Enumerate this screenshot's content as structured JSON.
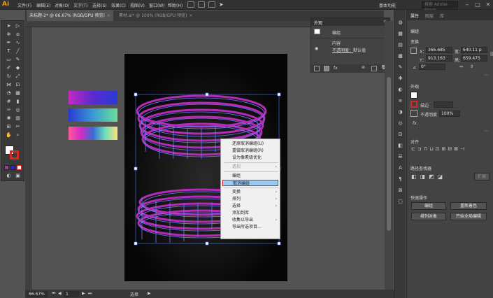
{
  "app": {
    "logo": "Ai"
  },
  "menu": [
    "文件(F)",
    "编辑(E)",
    "对象(O)",
    "文字(T)",
    "选择(S)",
    "效果(C)",
    "视图(V)",
    "窗口(W)",
    "帮助(H)"
  ],
  "topbar": {
    "workspace": "基本功能",
    "search_placeholder": "搜索 Adobe Stock"
  },
  "tabs": [
    {
      "label": "未标题-2* @ 66.67% (RGB/GPU 预览)",
      "active": true
    },
    {
      "label": "素材.ai* @ 100% (RGB/GPU 预览)",
      "active": false
    }
  ],
  "appearance": {
    "title": "外观",
    "rows": [
      {
        "label": "编组"
      },
      {
        "label": "内容"
      },
      {
        "label": "不透明度：",
        "value": "默认值"
      }
    ]
  },
  "context_menu": {
    "items": [
      {
        "label": "还原取消编组(U)",
        "disabled": false,
        "submenu": false
      },
      {
        "label": "重做取消编组(R)",
        "disabled": false,
        "submenu": false
      },
      {
        "label": "设为像素级优化",
        "disabled": false,
        "submenu": false,
        "sep_after": true
      },
      {
        "label": "透视",
        "disabled": true,
        "submenu": true,
        "sep_after": true
      },
      {
        "label": "编组",
        "disabled": false,
        "submenu": false
      },
      {
        "label": "取消编组",
        "disabled": false,
        "submenu": false,
        "highlighted": true,
        "sep_after": true
      },
      {
        "label": "变换",
        "disabled": false,
        "submenu": true
      },
      {
        "label": "排列",
        "disabled": false,
        "submenu": true
      },
      {
        "label": "选择",
        "disabled": false,
        "submenu": true
      },
      {
        "label": "添加到库",
        "disabled": false,
        "submenu": false
      },
      {
        "label": "收集以导出",
        "disabled": false,
        "submenu": true
      },
      {
        "label": "导出所选项目...",
        "disabled": false,
        "submenu": false
      }
    ]
  },
  "status": {
    "zoom": "66.67%",
    "page": "1",
    "tool": "选择"
  },
  "properties": {
    "tabs": [
      {
        "label": "属性",
        "active": true
      },
      {
        "label": "图层",
        "active": false
      },
      {
        "label": "库",
        "active": false
      }
    ],
    "group_label": "编组",
    "transform_label": "变换",
    "x": "366.685",
    "y": "913.163",
    "w": "640.11 p",
    "h": "659.475",
    "angle": "0°",
    "appearance_label": "外观",
    "stroke_label": "描边",
    "opacity_label": "不透明度",
    "opacity": "100%",
    "fx": "fx.",
    "align_label": "对齐",
    "pathfinder_label": "路径查找器",
    "expand_label": "扩展",
    "quick_actions_label": "快速操作",
    "buttons": [
      "编组",
      "重新着色",
      "排列对象",
      "开始全局编辑"
    ]
  },
  "colors": {
    "accent": "#ff9a00",
    "artwork": "#b42bb4",
    "artwork_stroke": "#6b7dff"
  }
}
